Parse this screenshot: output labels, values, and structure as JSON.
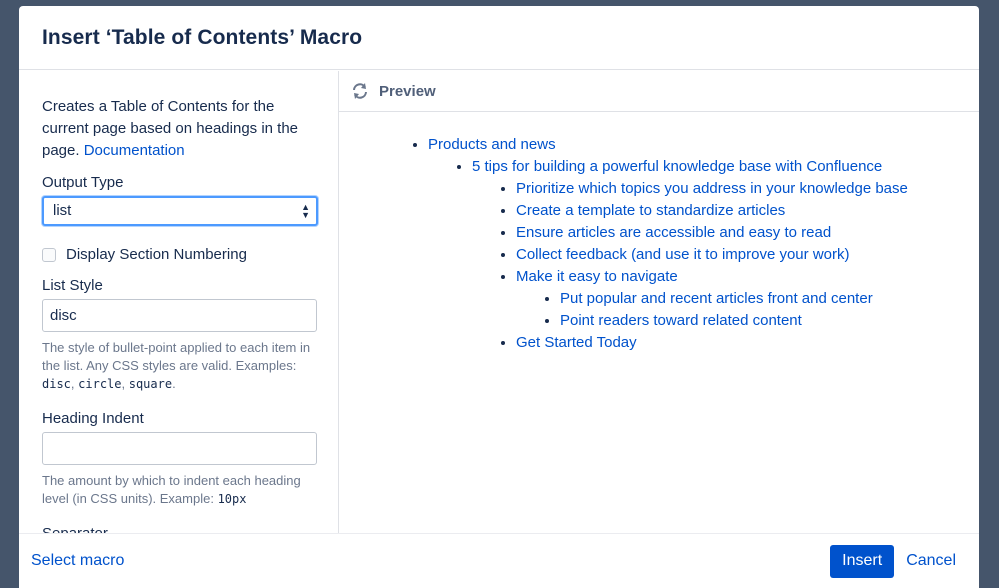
{
  "dialog": {
    "title": "Insert ‘Table of Contents’ Macro"
  },
  "left": {
    "description": "Creates a Table of Contents for the current page based on headings in the page.",
    "documentation_link": "Documentation",
    "output_type": {
      "label": "Output Type",
      "value": "list"
    },
    "section_numbering": {
      "label": "Display Section Numbering",
      "checked": false
    },
    "list_style": {
      "label": "List Style",
      "value": "disc",
      "help_prefix": "The style of bullet-point applied to each item in the list. Any CSS styles are valid. Examples:",
      "examples": [
        "disc",
        "circle",
        "square"
      ]
    },
    "heading_indent": {
      "label": "Heading Indent",
      "value": "",
      "help_prefix": "The amount by which to indent each heading level (in CSS units). Example:",
      "example": "10px"
    },
    "separator": {
      "label": "Separator"
    }
  },
  "preview": {
    "label": "Preview",
    "toc": {
      "l1": "Products and news",
      "l2": "5 tips for building a powerful knowledge base with Confluence",
      "l3": [
        "Prioritize which topics you address in your knowledge base",
        "Create a template to standardize articles",
        "Ensure articles are accessible and easy to read",
        "Collect feedback (and use it to improve your work)",
        "Make it easy to navigate"
      ],
      "l4": [
        "Put popular and recent articles front and center",
        "Point readers toward related content"
      ],
      "l3_last": "Get Started Today"
    }
  },
  "footer": {
    "select_macro": "Select macro",
    "insert": "Insert",
    "cancel": "Cancel"
  },
  "colors": {
    "link": "#0052cc",
    "text": "#172b4d",
    "focus": "#4c9aff",
    "backdrop": "#45556b"
  }
}
